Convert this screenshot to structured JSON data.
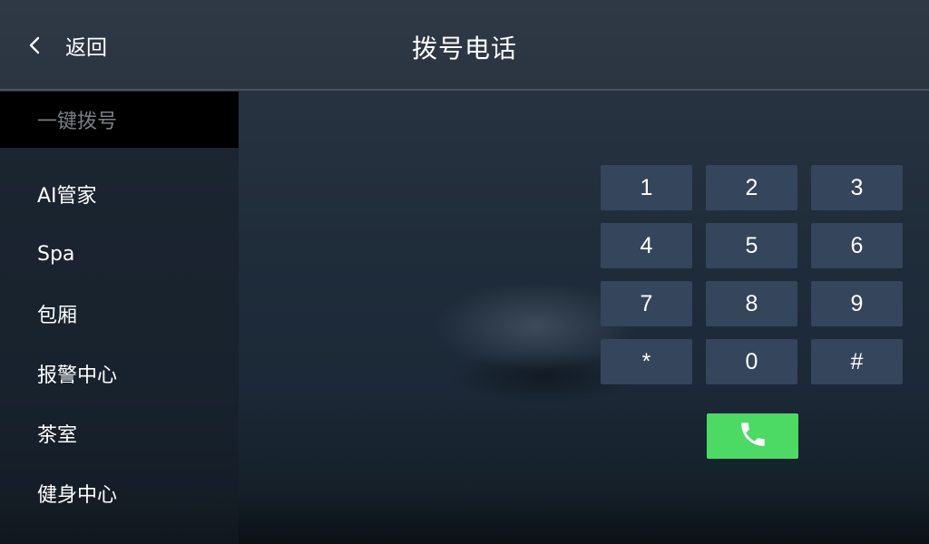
{
  "header": {
    "back_label": "返回",
    "title": "拨号电话",
    "back_icon": "chevron-left-icon"
  },
  "sidebar": {
    "items": [
      {
        "label": "一键拨号",
        "active": true
      },
      {
        "label": "AI管家",
        "active": false
      },
      {
        "label": "Spa",
        "active": false
      },
      {
        "label": "包厢",
        "active": false
      },
      {
        "label": "报警中心",
        "active": false
      },
      {
        "label": "茶室",
        "active": false
      },
      {
        "label": "健身中心",
        "active": false
      }
    ]
  },
  "keypad": {
    "keys": [
      "1",
      "2",
      "3",
      "4",
      "5",
      "6",
      "7",
      "8",
      "9",
      "*",
      "0",
      "#"
    ],
    "call_icon": "phone-icon"
  },
  "colors": {
    "key_bg": "#34455c",
    "call_bg": "#4cd964",
    "active_item_bg": "#000000",
    "active_item_text": "#7a7f86"
  }
}
